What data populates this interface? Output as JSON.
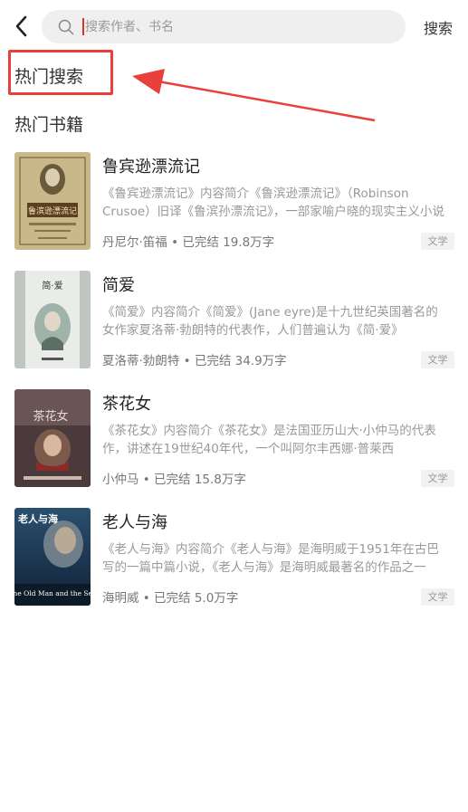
{
  "topbar": {
    "back_icon": "chevron-left-icon",
    "search_icon": "search-icon",
    "search_placeholder": "搜索作者、书名",
    "search_value": "",
    "search_button_label": "搜索"
  },
  "hot_search": {
    "title": "热门搜索"
  },
  "annotation": {
    "highlight_color": "#e8413c"
  },
  "hot_books": {
    "title": "热门书籍",
    "items": [
      {
        "name": "鲁宾逊漂流记",
        "description": "《鲁宾逊漂流记》内容简介《鲁滨逊漂流记》（Robinson Crusoe）旧译《鲁滨孙漂流记》，一部家喻户晓的现实主义小说",
        "meta": "丹尼尔·笛福 • 已完结  19.8万字",
        "tag": "文学",
        "cover_title": "鲁滨逊漂流记"
      },
      {
        "name": "简爱",
        "description": "《简爱》内容简介《简爱》(Jane eyre)是十九世纪英国著名的女作家夏洛蒂·勃朗特的代表作，人们普遍认为《简·爱》",
        "meta": "夏洛蒂·勃朗特 • 已完结  34.9万字",
        "tag": "文学",
        "cover_title": "简·爱"
      },
      {
        "name": "茶花女",
        "description": "《茶花女》内容简介《茶花女》是法国亚历山大·小仲马的代表作，讲述在19世纪40年代，一个叫阿尔丰西娜·普莱西",
        "meta": "小仲马 • 已完结  15.8万字",
        "tag": "文学",
        "cover_title": "茶花女"
      },
      {
        "name": "老人与海",
        "description": "《老人与海》内容简介《老人与海》是海明威于1951年在古巴写的一篇中篇小说，《老人与海》是海明威最著名的作品之一",
        "meta": "海明威 • 已完结  5.0万字",
        "tag": "文学",
        "cover_title": "老人与海",
        "cover_subtitle": "The Old Man and the Sea"
      }
    ]
  }
}
